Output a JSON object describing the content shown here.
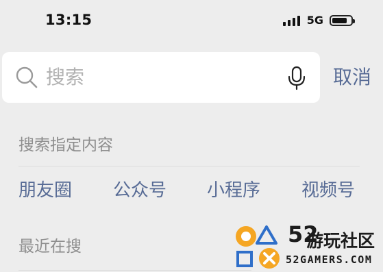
{
  "status_bar": {
    "time": "13:15",
    "network": "5G",
    "signal_bars": 4,
    "battery_level": 0.8
  },
  "search": {
    "placeholder": "搜索",
    "cancel_label": "取消"
  },
  "specified_content": {
    "title": "搜索指定内容",
    "categories": [
      "朋友圈",
      "公众号",
      "小程序",
      "视频号"
    ]
  },
  "recent": {
    "title": "最近在搜"
  },
  "watermark": {
    "number": "52",
    "name": "游玩社区",
    "domain": "52GAMERS.COM"
  },
  "colors": {
    "link": "#576b95",
    "muted": "#8e8e8e",
    "background": "#ededed",
    "logo_orange": "#f5a623",
    "logo_blue": "#2f6fc9"
  }
}
